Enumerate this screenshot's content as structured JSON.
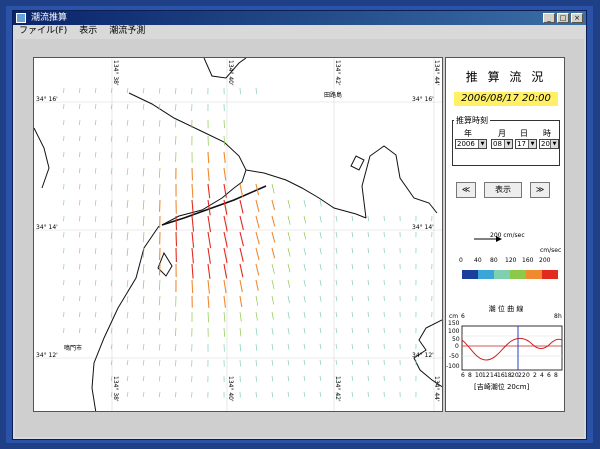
{
  "window": {
    "title": "潮流推算"
  },
  "menu": [
    "ファイル(F)",
    "表示",
    "潮流予測"
  ],
  "map": {
    "lat_labels_left": [
      "34° 16'",
      "34° 14'",
      "34° 12'"
    ],
    "lat_labels_right": [
      "34° 16'",
      "34° 14'",
      "34° 12'"
    ],
    "lon_labels_top": [
      "134° 38'",
      "134° 40'",
      "134° 42'",
      "134° 44'"
    ],
    "lon_labels_bottom": [
      "134° 38'",
      "134° 40'",
      "134° 42'",
      "134° 44'"
    ],
    "places": {
      "island": "田路島",
      "city": "鳴門市"
    }
  },
  "panel": {
    "title": "推 算 流 況",
    "datetime": "2006/08/17 20:00",
    "group_label": "推算時刻",
    "fields": {
      "year": {
        "label": "年",
        "value": "2006"
      },
      "month": {
        "label": "月",
        "value": "08"
      },
      "day": {
        "label": "日",
        "value": "17"
      },
      "hour": {
        "label": "時",
        "value": "20"
      }
    },
    "buttons": {
      "prev": "≪",
      "show": "表示",
      "next": "≫"
    },
    "scale_label": "200 cm/sec",
    "color_legend": {
      "unit": "cm/sec",
      "ticks": [
        "0",
        "40",
        "80",
        "120",
        "160",
        "200"
      ],
      "colors": [
        "#1c3f9c",
        "#3aa6d8",
        "#7fd0b0",
        "#8cc84a",
        "#f08a30",
        "#e22a1e"
      ]
    },
    "tide": {
      "title": "潮 位 曲 線",
      "y_unit": "cm",
      "x_unit": "h",
      "y_ticks": [
        "150",
        "100",
        "50",
        "0",
        "-50",
        "-100"
      ],
      "x_ticks": [
        "6",
        "8",
        "10",
        "12",
        "14",
        "16",
        "18",
        "20",
        "22",
        "0",
        "2",
        "4",
        "6",
        "8"
      ],
      "caption": "[吉崎潮位 20cm]"
    }
  }
}
